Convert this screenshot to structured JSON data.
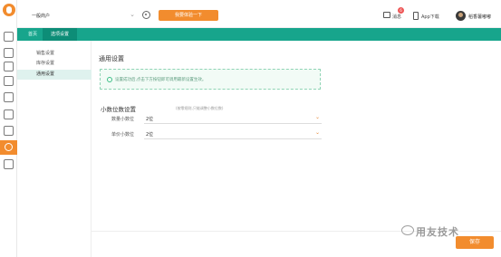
{
  "header": {
    "account_select": "一般商户",
    "try_button": "我要体验一下",
    "messages_label": "消息",
    "messages_badge": "6",
    "app_download": "App下载",
    "user_name": "稻香薯嘟嘟"
  },
  "tabs": [
    {
      "label": "首页"
    },
    {
      "label": "选项设置"
    }
  ],
  "subnav": {
    "items": [
      {
        "label": "销售设置"
      },
      {
        "label": "库存设置"
      },
      {
        "label": "通用设置"
      }
    ]
  },
  "main": {
    "title": "通用设置",
    "notice": "设置成功后,点击下方按钮即可调用最新设置生效。",
    "decimal_section": {
      "title": "小数位数设置",
      "hint": "(按零规则,只能调整小数位数)",
      "fields": [
        {
          "label": "数量小数位",
          "value": "2位"
        },
        {
          "label": "单价小数位",
          "value": "2位"
        }
      ]
    },
    "save_button": "保存"
  },
  "watermark": "用友技术",
  "colors": {
    "brand_orange": "#f28c2e",
    "teal": "#17a58c"
  },
  "icons": {
    "logo": "rabbit-logo-icon",
    "rail": [
      "home-icon",
      "shop-icon",
      "bag-icon",
      "package-icon",
      "house-icon",
      "clipboard-icon",
      "table-icon",
      "gear-icon",
      "report-icon"
    ]
  }
}
